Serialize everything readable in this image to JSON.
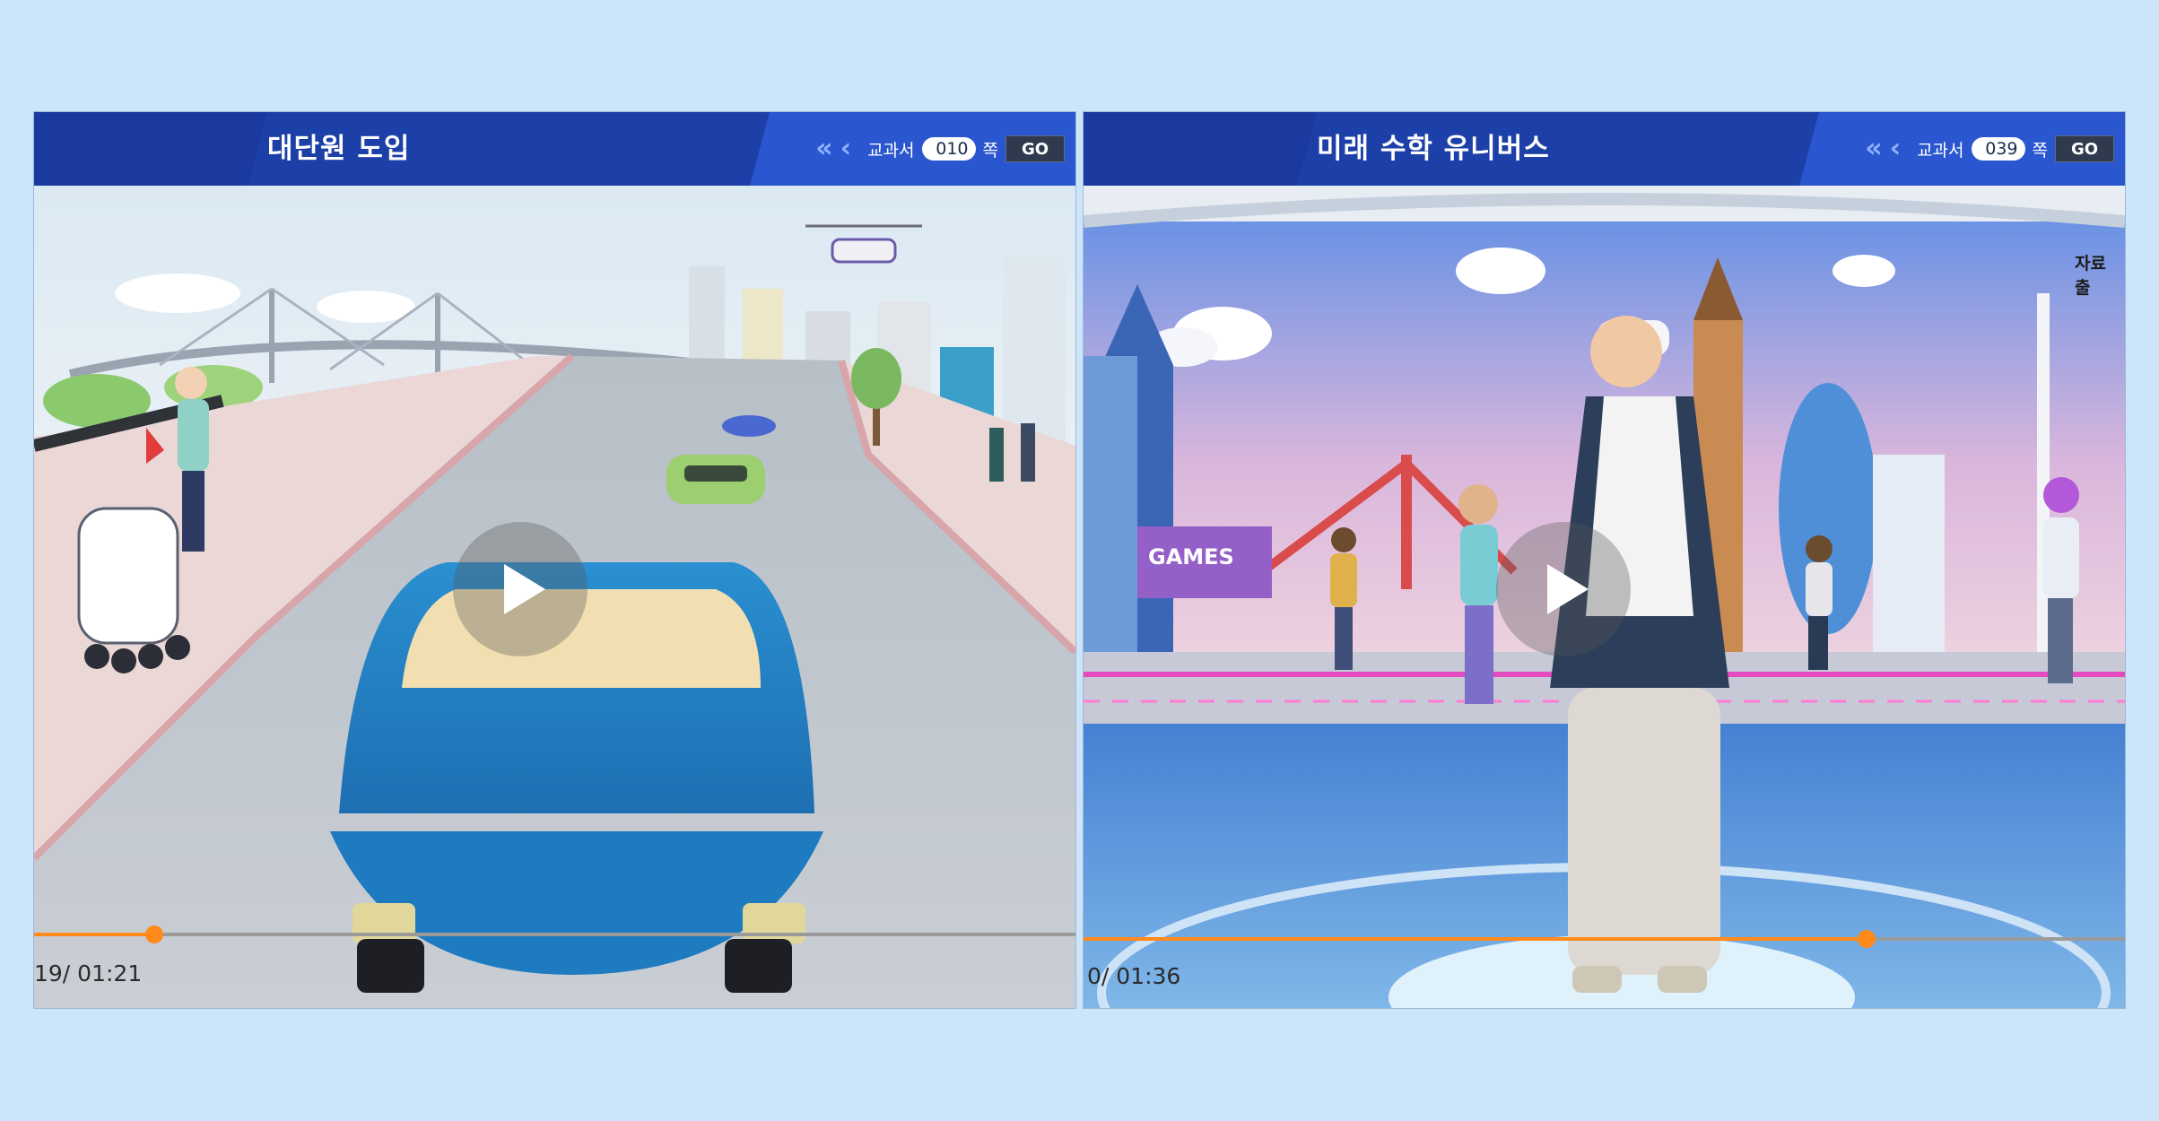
{
  "left_panel": {
    "title": "대단원 도입",
    "nav": {
      "first_icon": "«",
      "prev_icon": "‹",
      "textbook_label": "교과서",
      "page_value": "010",
      "page_unit": "쪽",
      "go_label": "GO"
    },
    "video": {
      "time_text": "19/ 01:21",
      "progress": 0.115
    }
  },
  "right_panel": {
    "title": "미래 수학 유니버스",
    "nav": {
      "first_icon": "«",
      "prev_icon": "‹",
      "textbook_label": "교과서",
      "page_value": "039",
      "page_unit": "쪽",
      "go_label": "GO"
    },
    "video": {
      "time_text": "0/ 01:36",
      "progress": 0.752,
      "games_sign": "GAMES",
      "corner_text": "자료 출"
    }
  },
  "colors": {
    "background": "#cde5fb",
    "header": "#2a56cf",
    "progress": "#ff8a1a"
  }
}
